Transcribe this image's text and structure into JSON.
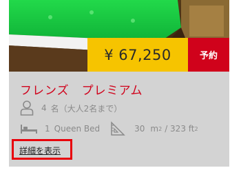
{
  "room": {
    "price": "¥ 67,250",
    "book_label": "予約",
    "name": "フレンズ　プレミアム",
    "occupancy_count": "4",
    "occupancy_text": "名（大人2名まで）",
    "bed_count": "1",
    "bed_type": "Queen Bed",
    "size_value": "30",
    "size_unit": "m",
    "size_sep": "/ 323 ft",
    "size_sup": "2",
    "details_link": "詳細を表示"
  },
  "icons": [
    "person-icon",
    "bed-icon",
    "ruler-triangle-icon"
  ],
  "colors": {
    "accent_red": "#d0021b",
    "price_yellow": "#f6c400",
    "card_bg": "#d3d3d3",
    "highlight_red": "#e8000b"
  }
}
